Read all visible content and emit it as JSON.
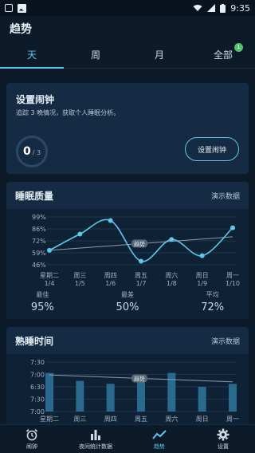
{
  "status_bar": {
    "time": "9:35"
  },
  "app_title": "趋势",
  "tabs": [
    {
      "label": "天",
      "active": true
    },
    {
      "label": "周",
      "active": false
    },
    {
      "label": "月",
      "active": false
    },
    {
      "label": "全部",
      "active": false,
      "badge": "1"
    }
  ],
  "alarm_card": {
    "title": "设置闹钟",
    "desc": "追踪 3 晚情况，获取个人睡眠分析。",
    "progress_current": "0",
    "progress_total": "/ 3",
    "button": "设置闹钟"
  },
  "quality_panel": {
    "title": "睡眠质量",
    "link": "演示数据",
    "trend_label": "趋势",
    "stats": [
      {
        "label": "最佳",
        "value": "95%"
      },
      {
        "label": "最差",
        "value": "50%"
      },
      {
        "label": "平均",
        "value": "72%"
      }
    ]
  },
  "time_panel": {
    "title": "熟睡时间",
    "link": "演示数据",
    "trend_label": "趋势"
  },
  "bottom_nav": [
    {
      "label": "闹钟",
      "icon": "alarm-clock-icon",
      "active": false
    },
    {
      "label": "夜间统计数据",
      "icon": "bar-chart-icon",
      "active": false
    },
    {
      "label": "趋势",
      "icon": "trend-line-icon",
      "active": true
    },
    {
      "label": "设置",
      "icon": "gear-icon",
      "active": false
    }
  ],
  "colors": {
    "accent": "#5ec7ea",
    "badge": "#4fc36a",
    "card": "#142b43",
    "bg": "#0d1a29"
  },
  "chart_data": [
    {
      "type": "line",
      "title": "睡眠质量",
      "y_ticks": [
        "99%",
        "86%",
        "72%",
        "59%",
        "46%"
      ],
      "ylim": [
        46,
        99
      ],
      "categories": [
        {
          "day": "星期二",
          "date": "1/4"
        },
        {
          "day": "周三",
          "date": "1/5"
        },
        {
          "day": "周四",
          "date": "1/6"
        },
        {
          "day": "周五",
          "date": "1/7"
        },
        {
          "day": "周六",
          "date": "1/8"
        },
        {
          "day": "周日",
          "date": "1/9"
        },
        {
          "day": "周一",
          "date": "1/10"
        }
      ],
      "values": [
        62,
        80,
        95,
        50,
        74,
        56,
        87
      ],
      "trend": [
        62,
        77
      ]
    },
    {
      "type": "bar",
      "title": "熟睡时间",
      "y_ticks": [
        "7:30",
        "7:00",
        "6:30",
        "7:30",
        "7:00"
      ],
      "categories": [
        "星期二",
        "周三",
        "周四",
        "周五",
        "周六",
        "周日",
        "周一"
      ],
      "values": [
        0.78,
        0.62,
        0.56,
        0.62,
        0.78,
        0.5,
        0.56
      ],
      "trend": [
        0.74,
        0.6
      ]
    }
  ]
}
